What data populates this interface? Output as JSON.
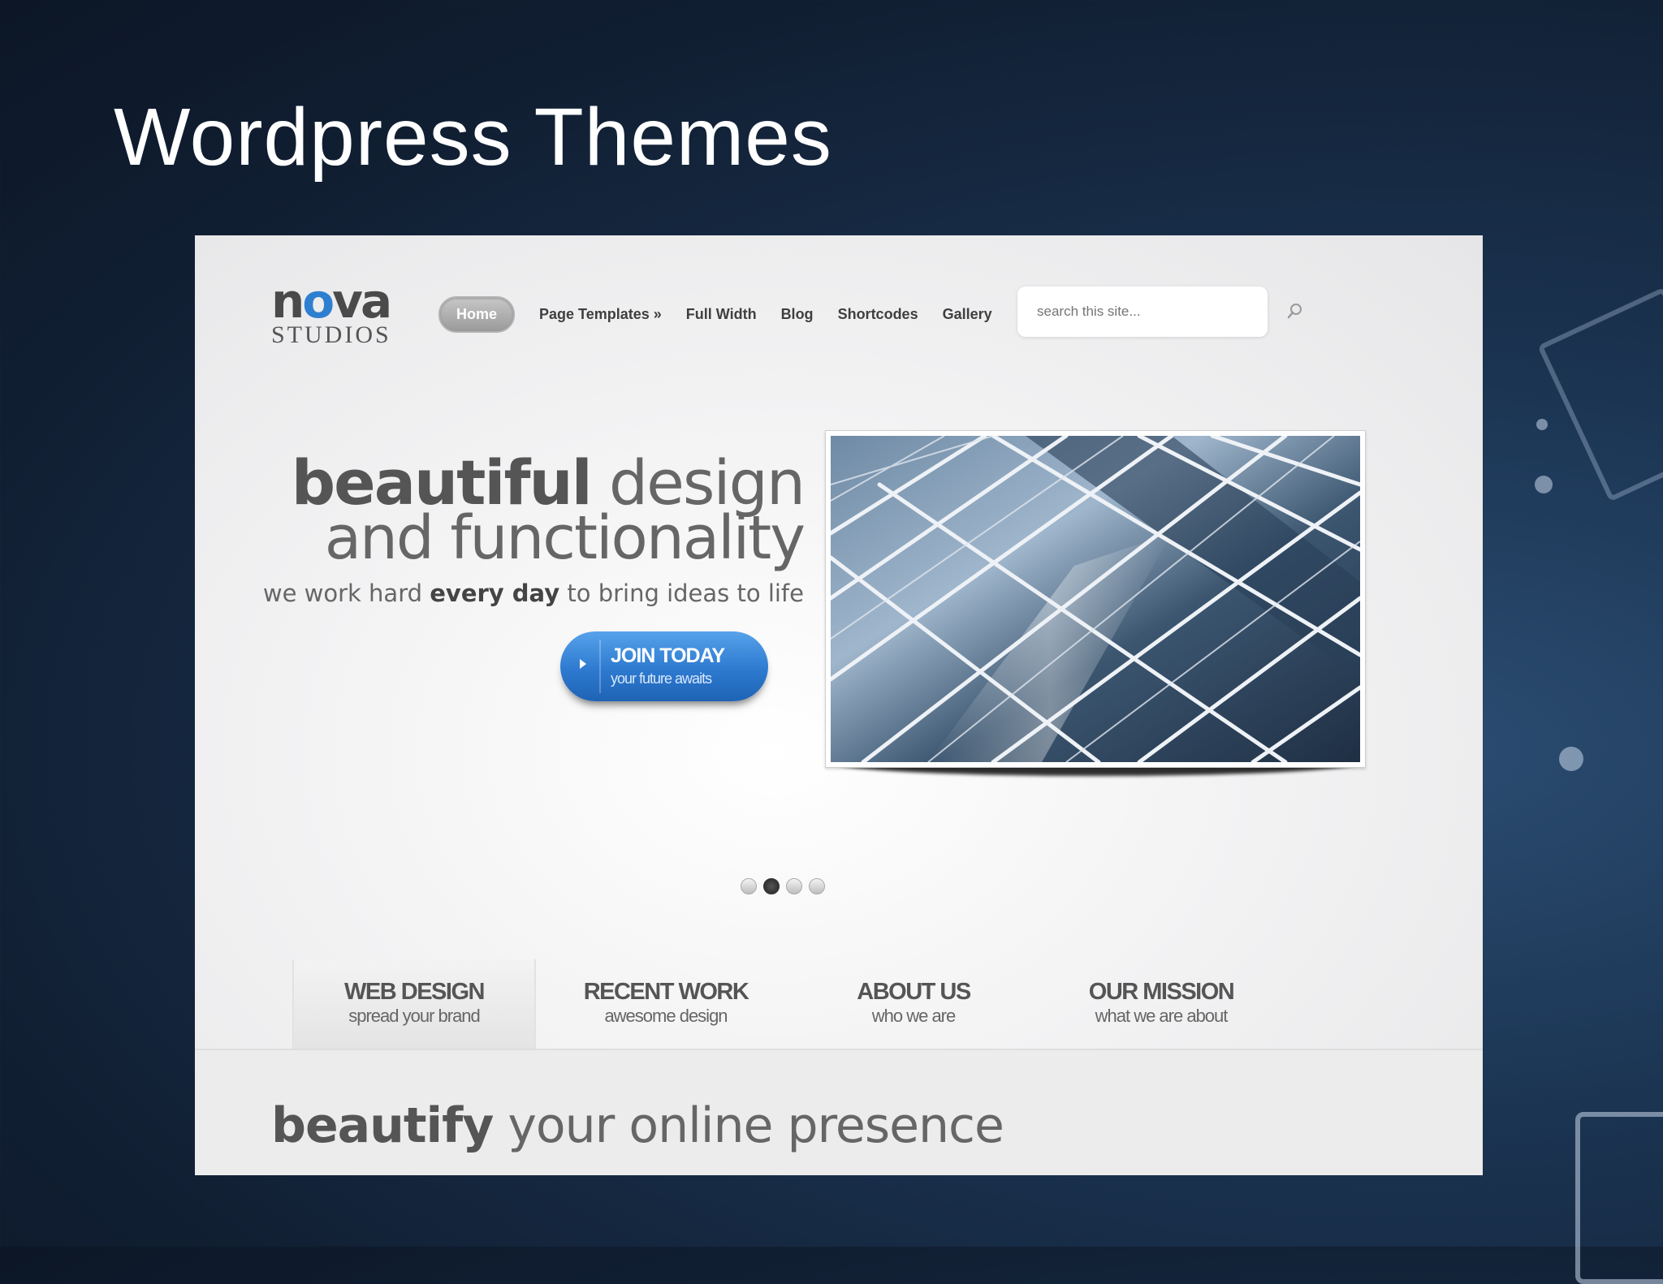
{
  "slide": {
    "title": "Wordpress Themes"
  },
  "site": {
    "logo": {
      "nova_n": "n",
      "nova_o": "o",
      "nova_va": "va",
      "studios": "STUDIOS"
    },
    "nav": [
      {
        "label": "Home",
        "active": true
      },
      {
        "label": "Page Templates »"
      },
      {
        "label": "Full Width"
      },
      {
        "label": "Blog"
      },
      {
        "label": "Shortcodes"
      },
      {
        "label": "Gallery"
      }
    ],
    "search": {
      "placeholder": "search this site..."
    },
    "hero": {
      "line1_bold": "beautiful",
      "line1_light": "design",
      "line2": "and functionality",
      "sub_pre": "we work hard ",
      "sub_bold": "every day",
      "sub_post": " to bring ideas to life",
      "button_title": "JOIN TODAY",
      "button_sub": "your future awaits"
    },
    "slider": {
      "count": 4,
      "active_index": 1
    },
    "tabs": [
      {
        "title": "WEB DESIGN",
        "sub": "spread your brand",
        "active": true
      },
      {
        "title": "RECENT WORK",
        "sub": "awesome design"
      },
      {
        "title": "ABOUT US",
        "sub": "who we are"
      },
      {
        "title": "OUR MISSION",
        "sub": "what we are about"
      }
    ],
    "tagline": {
      "bold": "beautify",
      "rest": "your online presence"
    }
  },
  "colors": {
    "accent": "#2d7ad0",
    "logo_o": "#2f7fd0",
    "slide_bg": "#111f33"
  }
}
